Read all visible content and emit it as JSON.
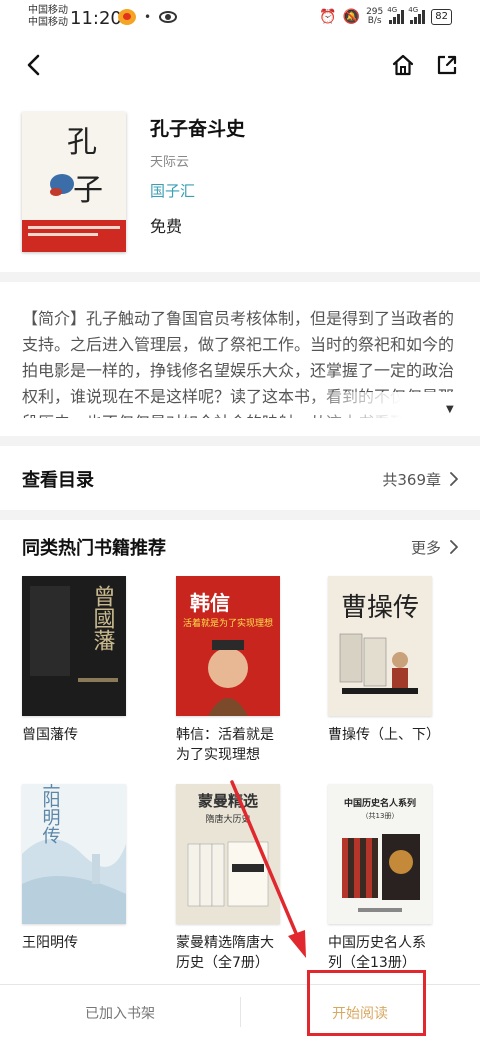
{
  "status_bar": {
    "carrier_1": "中国移动",
    "carrier_2": "中国移动",
    "time": "11:20",
    "net_speed_value": "295",
    "net_speed_unit": "B/s",
    "signal_1_label": "4G",
    "signal_2_label": "4G",
    "battery": "82"
  },
  "book": {
    "title": "孔子奋斗史",
    "author": "天际云",
    "publisher": "国子汇",
    "price": "免费",
    "cover_title_chars": [
      "孔",
      "子"
    ]
  },
  "intro": {
    "label": "【简介】",
    "text": "孔子触动了鲁国官员考核体制，但是得到了当政者的支持。之后进入管理层，做了祭祀工作。当时的祭祀和如今的拍电影是一样的，挣钱修名望娱乐大众，还掌握了一定的政治权利，谁说现在不是这样呢？读了这本书，看到的不仅仅是那段历史，也不仅仅是对如今社会的映射。从这本书看到的，"
  },
  "toc": {
    "label": "查看目录",
    "count": "共369章"
  },
  "recommend": {
    "title": "同类热门书籍推荐",
    "more": "更多",
    "books": [
      {
        "name": "曾国藩传",
        "cover_text": "曾國藩",
        "cover_color": "#1c1c1c"
      },
      {
        "name": "韩信：活着就是为了实现理想",
        "cover_text": "韩信",
        "cover_subtitle": "活着就是为了实现理想",
        "cover_color": "#c8251f"
      },
      {
        "name": "曹操传（上、下）",
        "cover_text": "曹操传",
        "cover_color": "#f2ece0"
      },
      {
        "name": "王阳明传",
        "cover_text": "王阳明传",
        "cover_color": "#eef3f6"
      },
      {
        "name": "蒙曼精选隋唐大历史（全7册）",
        "cover_text": "蒙曼精选",
        "cover_subtitle": "隋唐大历史",
        "cover_color": "#e9e4d6"
      },
      {
        "name": "中国历史名人系列（全13册）",
        "cover_text": "中国历史名人系列",
        "cover_subtitle": "（共13册）",
        "cover_color": "#f5f5f2"
      }
    ]
  },
  "bottom": {
    "shelf_label": "已加入书架",
    "read_label": "开始阅读"
  },
  "colors": {
    "accent_teal": "#3aa0b4",
    "read_button": "#d9a860",
    "annotation_red": "#e0282e"
  }
}
